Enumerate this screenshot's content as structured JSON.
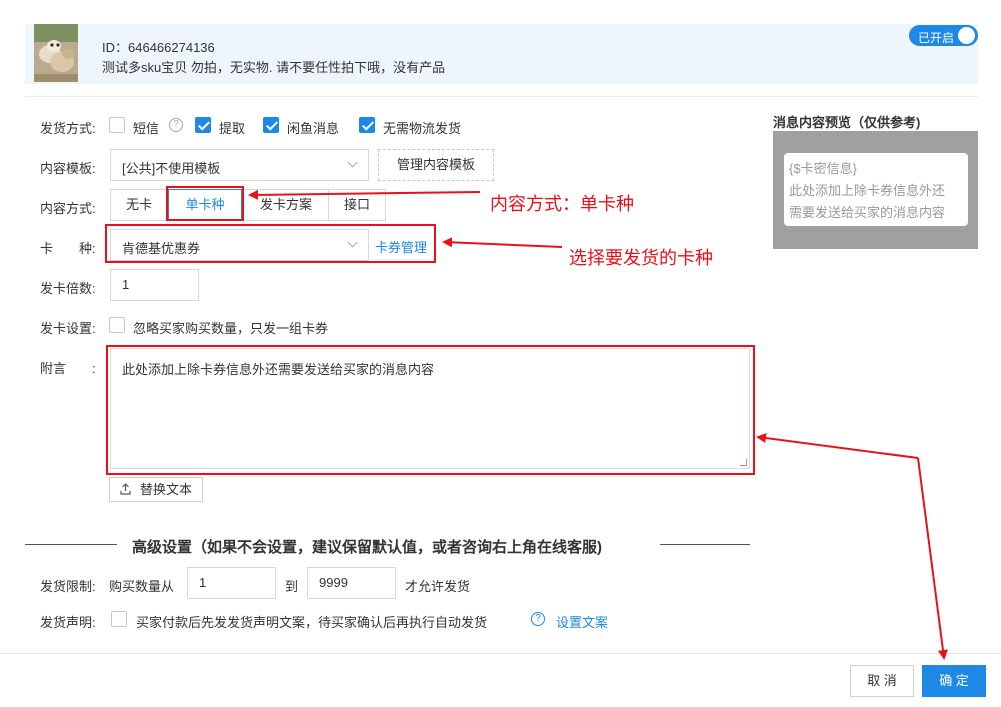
{
  "product": {
    "id_label": "ID：646466274136",
    "description": "测试多sku宝贝 勿拍，无实物. 请不要任性拍下哦，没有产品",
    "toggle_label": "已开启"
  },
  "delivery_method": {
    "label": "发货方式:",
    "options": [
      {
        "label": "短信",
        "checked": false
      },
      {
        "label": "提取",
        "checked": true
      },
      {
        "label": "闲鱼消息",
        "checked": true
      },
      {
        "label": "无需物流发货",
        "checked": true
      }
    ]
  },
  "content_template": {
    "label": "内容模板:",
    "selected": "[公共]不使用模板",
    "manage_button": "管理内容模板"
  },
  "content_mode": {
    "label": "内容方式:",
    "options": [
      "无卡",
      "单卡种",
      "发卡方案",
      "接口"
    ],
    "selected_index": 1
  },
  "card_type": {
    "label": "卡　　种:",
    "selected": "肯德基优惠券",
    "manage_link": "卡券管理"
  },
  "multiplier": {
    "label": "发卡倍数:",
    "value": "1"
  },
  "card_settings": {
    "label": "发卡设置:",
    "option": "忽略买家购买数量，只发一组卡券"
  },
  "postscript": {
    "label": "附言　　:",
    "value": "此处添加上除卡券信息外还需要发送给买家的消息内容",
    "replace_button": "替换文本"
  },
  "advanced": {
    "title": "高级设置（如果不会设置，建议保留默认值，或者咨询右上角在线客服)",
    "limit": {
      "label": "发货限制:",
      "prefix": "购买数量从",
      "min": "1",
      "middle": "到",
      "max": "9999",
      "suffix": "才允许发货"
    },
    "statement": {
      "label": "发货声明:",
      "text": "买家付款后先发发货声明文案，待买家确认后再执行自动发货",
      "link": "设置文案"
    }
  },
  "preview": {
    "title": "消息内容预览（仅供参考)",
    "lines": [
      "{$卡密信息}",
      "此处添加上除卡券信息外还",
      "需要发送给买家的消息内容"
    ]
  },
  "annotations": {
    "content_mode_note": "内容方式：单卡种",
    "card_type_note": "选择要发货的卡种"
  },
  "footer": {
    "cancel": "取 消",
    "ok": "确 定"
  },
  "colors": {
    "accent": "#1e88e5",
    "annotation": "#e8111b"
  }
}
